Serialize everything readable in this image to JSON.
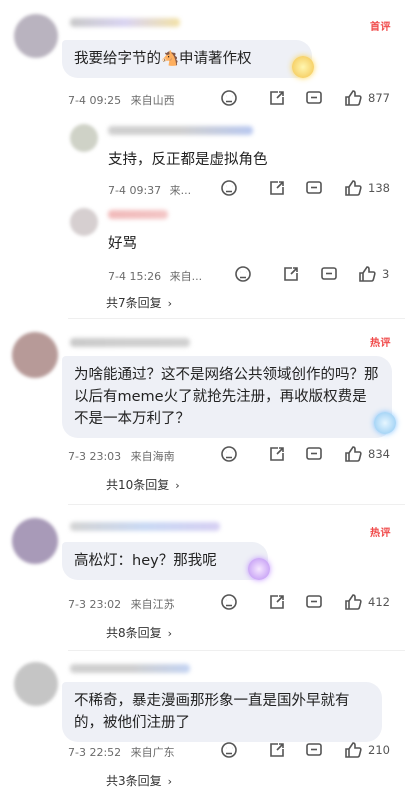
{
  "comments": [
    {
      "tag": "首评",
      "text": "我要给字节的🐴申请著作权",
      "time": "7-4 09:25",
      "location": "来自山西",
      "likes": "877",
      "replies": [
        {
          "text": "支持，反正都是虚拟角色",
          "time": "7-4 09:37",
          "location": "来...",
          "likes": "138"
        },
        {
          "text": "好骂",
          "time": "7-4 15:26",
          "location": "来自...",
          "likes": "3"
        }
      ],
      "reply_count": "共7条回复"
    },
    {
      "tag": "热评",
      "text": "为啥能通过？这不是网络公共领域创作的吗？那以后有meme火了就抢先注册，再收版权费是不是一本万利了？",
      "time": "7-3 23:03",
      "location": "来自海南",
      "likes": "834",
      "reply_count": "共10条回复"
    },
    {
      "tag": "热评",
      "text": "高松灯：hey？那我呢",
      "time": "7-3 23:02",
      "location": "来自江苏",
      "likes": "412",
      "reply_count": "共8条回复"
    },
    {
      "text": "不稀奇，暴走漫画那形象一直是国外早就有的，被他们注册了",
      "time": "7-3 22:52",
      "location": "来自广东",
      "likes": "210",
      "reply_count": "共3条回复"
    }
  ],
  "icons": [
    "dislike-icon",
    "share-icon",
    "comment-icon",
    "like-icon",
    "chevron-right-icon"
  ]
}
